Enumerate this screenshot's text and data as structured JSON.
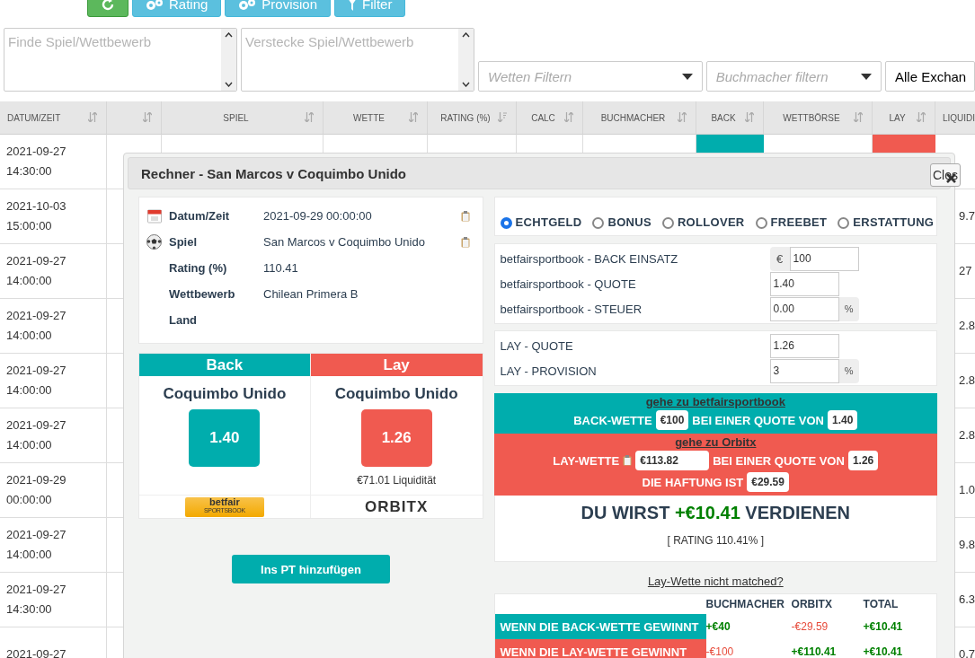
{
  "toolbar": {
    "buttons": [
      {
        "kind": "refresh"
      },
      {
        "kind": "gears",
        "label": "Rating"
      },
      {
        "kind": "gears",
        "label": "Provision"
      },
      {
        "kind": "filter",
        "label": "Filter"
      }
    ]
  },
  "filters": {
    "find": {
      "placeholder": "Finde Spiel/Wettbewerb"
    },
    "hide": {
      "placeholder": "Verstecke Spiel/Wettbewerb"
    },
    "selects": [
      {
        "placeholder": "Wetten Filtern"
      },
      {
        "placeholder": "Buchmacher filtern"
      },
      {
        "value": "Alle Exchan"
      }
    ]
  },
  "table": {
    "columns": [
      {
        "label": "DATUM/ZEIT",
        "sorted": false
      },
      {
        "sorted": false
      },
      {
        "label": "SPIEL",
        "sorted": false
      },
      {
        "label": "WETTE",
        "sorted": false
      },
      {
        "label": "RATING (%)",
        "sorted": true
      },
      {
        "label": "CALC",
        "sorted": false
      },
      {
        "label": "BUCHMACHER",
        "sorted": false
      },
      {
        "label": "BACK",
        "sorted": false
      },
      {
        "label": "WETTBÖRSE",
        "sorted": false
      },
      {
        "label": "LAY",
        "sorted": false
      },
      {
        "label": "LIQUIDI"
      }
    ],
    "rows": [
      {
        "date": "2021-09-27",
        "time": "14:30:00",
        "marked": true
      },
      {
        "date": "2021-10-03",
        "time": "15:00:00",
        "liquidity": "9.7",
        "marked": false
      },
      {
        "date": "2021-09-27",
        "time": "14:00:00",
        "liquidity": "27",
        "marked": false
      },
      {
        "date": "2021-09-27",
        "time": "14:00:00",
        "liquidity": "2.8",
        "marked": false
      },
      {
        "date": "2021-09-27",
        "time": "14:00:00",
        "liquidity": "2.8",
        "marked": false
      },
      {
        "date": "2021-09-27",
        "time": "14:00:00",
        "liquidity": "2.8",
        "marked": false
      },
      {
        "date": "2021-09-29",
        "time": "00:00:00",
        "liquidity": "1.0",
        "marked": false
      },
      {
        "date": "2021-09-27",
        "time": "14:00:00",
        "liquidity": "9.8",
        "marked": false
      },
      {
        "date": "2021-09-27",
        "time": "14:30:00",
        "liquidity": "6.3",
        "marked": false
      },
      {
        "date": "2021-09-27",
        "liquidity": "0.7",
        "marked": false
      }
    ]
  },
  "calculator": {
    "title": "Rechner - San Marcos v Coquimbo Unido",
    "close_label": "Clos",
    "info": [
      {
        "label": "Datum/Zeit",
        "value": "2021-09-29 00:00:00",
        "copy": true
      },
      {
        "label": "Spiel",
        "value": "San Marcos v Coquimbo Unido",
        "copy": true
      },
      {
        "label": "Rating (%)",
        "value": "110.41",
        "copy": false
      },
      {
        "label": "Wettbewerb",
        "value": "Chilean Primera B",
        "copy": false
      },
      {
        "label": "Land",
        "copy": false
      }
    ],
    "sides": [
      {
        "kind": "back",
        "header": "Back",
        "team": "Coquimbo Unido",
        "odds": "1.40",
        "logo_top": "betfair",
        "logo_bottom": "SPORTSBOOK"
      },
      {
        "kind": "lay",
        "header": "Lay",
        "team": "Coquimbo Unido",
        "odds": "1.26",
        "liquidity": "€71.01 Liquidität",
        "logo_top": "ORBITX"
      }
    ],
    "add_button": "Ins PT hinzufügen",
    "bet_types": [
      {
        "label": "ECHTGELD",
        "selected": true
      },
      {
        "label": "BONUS",
        "selected": false
      },
      {
        "label": "ROLLOVER",
        "selected": false
      },
      {
        "label": "FREEBET",
        "selected": false
      },
      {
        "label": "ERSTATTUNG",
        "selected": false
      }
    ],
    "stake_fields": [
      {
        "label": "betfairsportbook - BACK EINSATZ",
        "value": "100",
        "prefix": "€"
      },
      {
        "label": "betfairsportbook - QUOTE",
        "value": "1.40"
      },
      {
        "label": "betfairsportbook - STEUER",
        "value": "0.00",
        "suffix": "%"
      }
    ],
    "lay_fields": [
      {
        "label": "LAY - QUOTE",
        "value": "1.26"
      },
      {
        "label": "LAY - PROVISION",
        "value": "3",
        "suffix": "%"
      }
    ],
    "back_instruction": {
      "link": "gehe zu betfairsportbook",
      "prefix": "BACK-WETTE",
      "stake": "€100",
      "middle": "BEI EINER QUOTE VON",
      "odds": "1.40"
    },
    "lay_instruction": {
      "link": "gehe zu Orbitx",
      "prefix": "LAY-WETTE",
      "stake": "€113.82",
      "middle": "BEI EINER QUOTE VON",
      "odds": "1.26",
      "liability_label": "DIE HAFTUNG IST",
      "liability": "€29.59"
    },
    "profit": {
      "before": "DU WIRST",
      "amount": "+€10.41",
      "after": "VERDIENEN",
      "rating": "[ RATING 110.41% ]"
    },
    "not_matched_link": "Lay-Wette nicht matched?",
    "outcomes": {
      "columns": [
        "BUCHMACHER",
        "ORBITX",
        "TOTAL"
      ],
      "rows": [
        {
          "kind": "back",
          "label": "WENN DIE BACK-WETTE GEWINNT",
          "values": [
            {
              "text": "+€40",
              "positive": true
            },
            {
              "text": "-€29.59",
              "positive": false
            },
            {
              "text": "+€10.41",
              "positive": true
            }
          ]
        },
        {
          "kind": "lay",
          "label": "WENN DIE LAY-WETTE GEWINNT",
          "values": [
            {
              "text": "-€100",
              "positive": false
            },
            {
              "text": "+€110.41",
              "positive": true
            },
            {
              "text": "+€10.41",
              "positive": true
            }
          ]
        }
      ]
    }
  }
}
